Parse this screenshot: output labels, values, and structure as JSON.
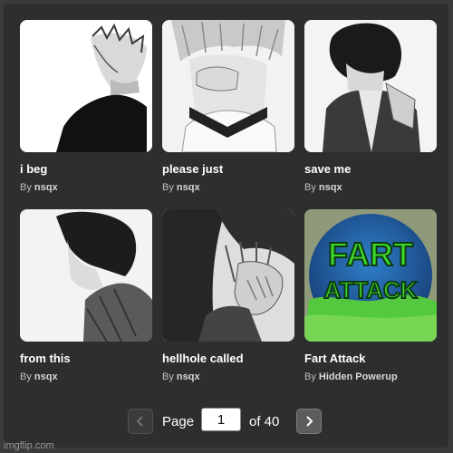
{
  "items": [
    {
      "title": "i beg",
      "by": "By",
      "author": "nsqx",
      "image": "manga-boy-profile-image"
    },
    {
      "title": "please just",
      "by": "By",
      "author": "nsqx",
      "image": "manga-boy-crying-image"
    },
    {
      "title": "save me",
      "by": "By",
      "author": "nsqx",
      "image": "manga-boy-jacket-image"
    },
    {
      "title": "from this",
      "by": "By",
      "author": "nsqx",
      "image": "manga-boy-side-image"
    },
    {
      "title": "hellhole called",
      "by": "By",
      "author": "nsqx",
      "image": "manga-boy-hand-face-image"
    },
    {
      "title": "Fart Attack",
      "by": "By",
      "author": "Hidden Powerup",
      "image": "fart-attack-logo-image",
      "logo_text": [
        "FART",
        "ATTACK"
      ]
    }
  ],
  "pagination": {
    "page_label": "Page",
    "current_page": "1",
    "of_label": "of 40",
    "prev_icon": "chevron-left-icon",
    "next_icon": "chevron-right-icon"
  },
  "watermark": "imgflip.com",
  "colors": {
    "background": "#2c2e30",
    "text": "#ffffff",
    "muted_text": "#bdbebe",
    "logo_green": "#3dd62b",
    "logo_blue": "#1f5fa8"
  }
}
